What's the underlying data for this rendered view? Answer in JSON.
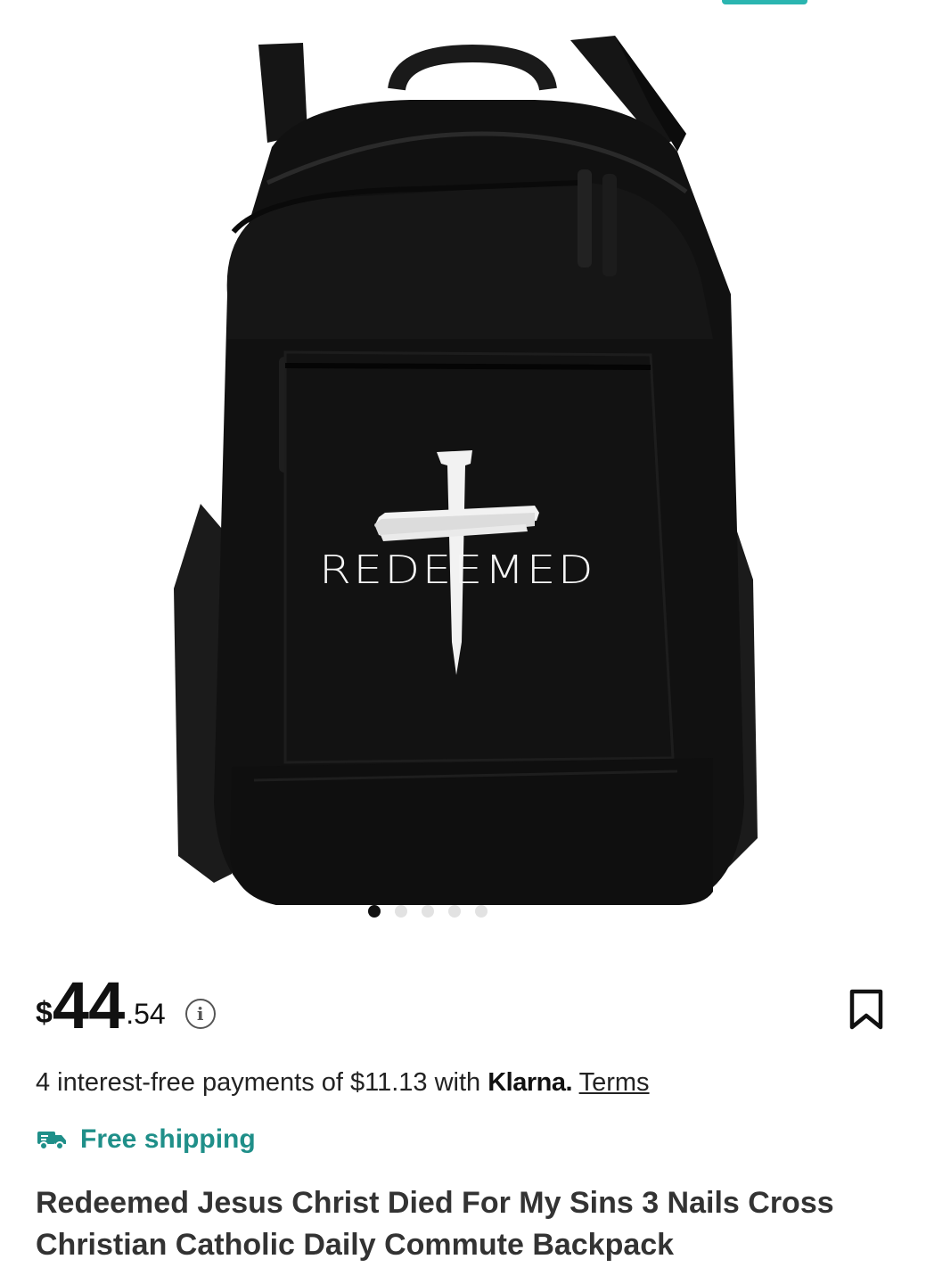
{
  "gallery": {
    "image_alt": "Black backpack with Redeemed nails cross print",
    "print_text": "REDEEMED",
    "dots_total": 5,
    "active_dot": 1
  },
  "price": {
    "currency": "$",
    "whole": "44",
    "fraction": ".54",
    "info_icon": "info-icon"
  },
  "klarna": {
    "text": "4 interest-free payments of $11.13 with ",
    "brand": "Klarna.",
    "terms": "Terms"
  },
  "shipping": {
    "label": "Free shipping",
    "icon": "truck-icon",
    "color": "#1f8f89"
  },
  "product": {
    "title": "Redeemed Jesus Christ Died For My Sins 3 Nails Cross Christian Catholic Daily Commute Backpack"
  },
  "colors": {
    "accent": "#2bb5b0"
  }
}
